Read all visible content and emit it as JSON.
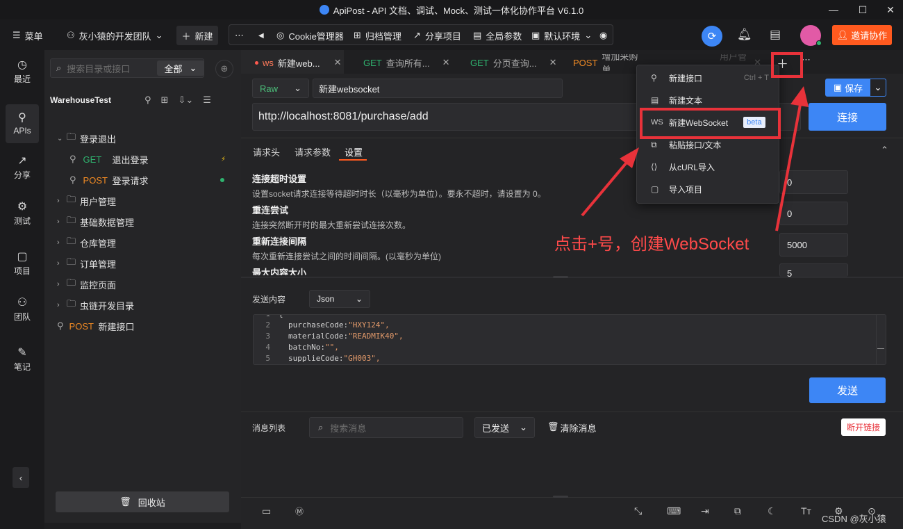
{
  "window": {
    "title": "ApiPost - API 文档、调试、Mock、测试一体化协作平台 V6.1.0"
  },
  "toolbar": {
    "menu": "菜单",
    "team": "灰小猿的开发团队",
    "new": "新建",
    "cookie": "Cookie管理器",
    "archive": "归档管理",
    "share": "分享项目",
    "global_params": "全局参数",
    "env": "默认环境",
    "invite": "邀请协作"
  },
  "rail": [
    "最近",
    "APIs",
    "分享",
    "测试",
    "项目",
    "团队",
    "笔记"
  ],
  "sidebar": {
    "search_placeholder": "搜索目录或接口",
    "filter": "全部",
    "project": "WarehouseTest",
    "tree": [
      {
        "label": "登录退出",
        "type": "folder",
        "open": true
      },
      {
        "method": "GET",
        "label": "退出登录",
        "type": "api"
      },
      {
        "method": "POST",
        "label": "登录请求",
        "type": "api"
      },
      {
        "label": "用户管理",
        "type": "folder"
      },
      {
        "label": "基础数据管理",
        "type": "folder"
      },
      {
        "label": "仓库管理",
        "type": "folder"
      },
      {
        "label": "订单管理",
        "type": "folder"
      },
      {
        "label": "监控页面",
        "type": "folder"
      },
      {
        "label": "虫链开发目录",
        "type": "folder"
      },
      {
        "method": "POST",
        "label": "新建接口",
        "type": "api"
      }
    ],
    "recycle": "回收站"
  },
  "tabs": [
    {
      "method": "ws",
      "label": "新建web..."
    },
    {
      "method": "GET",
      "label": "查询所有..."
    },
    {
      "method": "GET",
      "label": "分页查询..."
    },
    {
      "method": "POST",
      "label": "增加采购单"
    },
    {
      "method": "",
      "label": "用户管理"
    }
  ],
  "request": {
    "mode": "Raw",
    "name": "新建websocket",
    "url": "http://localhost:8081/purchase/add",
    "save": "保存",
    "connect": "连接",
    "subtabs": [
      "请求头",
      "请求参数",
      "设置"
    ],
    "settings": [
      {
        "title": "连接超时设置",
        "desc": "设置socket请求连接等待超时时长（以毫秒为单位）。要永不超时，请设置为 0。",
        "value": "0"
      },
      {
        "title": "重连尝试",
        "desc": "连接突然断开时的最大重新尝试连接次数。",
        "value": "0"
      },
      {
        "title": "重新连接间隔",
        "desc": "每次重新连接尝试之间的时间间隔。(以毫秒为单位)",
        "value": "5000"
      },
      {
        "title": "最大内容大小",
        "desc": "",
        "value": "5"
      }
    ]
  },
  "send": {
    "label": "发送内容",
    "format": "Json",
    "lines": [
      {
        "n": "1",
        "key": "{",
        "val": ""
      },
      {
        "n": "2",
        "key": "purchaseCode: ",
        "val": "\"HXY124\","
      },
      {
        "n": "3",
        "key": "materialCode: ",
        "val": "\"READMIK40\","
      },
      {
        "n": "4",
        "key": "batchNo: ",
        "val": "\"\","
      },
      {
        "n": "5",
        "key": "supplieCode: ",
        "val": "\"GH003\","
      }
    ],
    "button": "发送"
  },
  "messages": {
    "label": "消息列表",
    "search_placeholder": "搜索消息",
    "filter": "已发送",
    "clear": "清除消息",
    "disconnect": "断开链接"
  },
  "menu": {
    "items": [
      {
        "icon": "",
        "label": "新建接口",
        "shortcut": "Ctrl + T"
      },
      {
        "icon": "",
        "label": "新建文本",
        "shortcut": ""
      },
      {
        "icon": "WS",
        "label": "新建WebSocket",
        "badge": "beta"
      },
      {
        "icon": "",
        "label": "粘贴接口/文本",
        "shortcut": ""
      },
      {
        "icon": "",
        "label": "从cURL导入",
        "shortcut": ""
      },
      {
        "icon": "",
        "label": "导入项目",
        "shortcut": ""
      }
    ]
  },
  "annotation": "点击+号，创建WebSocket",
  "watermark": "CSDN @灰小猿",
  "colors": {
    "accent": "#3d86f5",
    "orange": "#ff5a1f",
    "red": "#e8323a",
    "get": "#2fb36f",
    "post": "#f08a24"
  }
}
